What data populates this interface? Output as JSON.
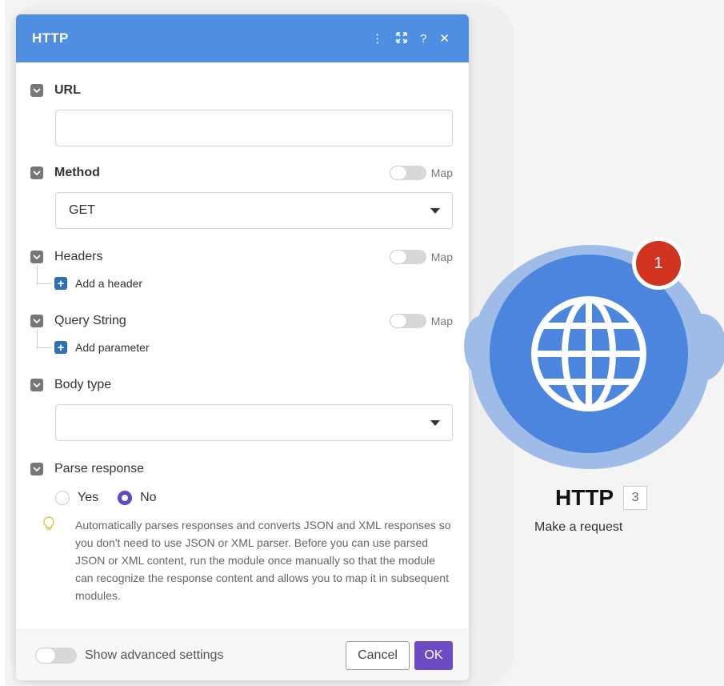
{
  "panel": {
    "title": "HTTP",
    "header_icons": [
      "more-icon",
      "expand-icon",
      "help-icon",
      "close-icon"
    ]
  },
  "fields": {
    "url": {
      "label": "URL",
      "value": ""
    },
    "method": {
      "label": "Method",
      "map_label": "Map",
      "value": "GET"
    },
    "headers": {
      "label": "Headers",
      "map_label": "Map",
      "add_label": "Add a header"
    },
    "query": {
      "label": "Query String",
      "map_label": "Map",
      "add_label": "Add parameter"
    },
    "body_type": {
      "label": "Body type",
      "value": ""
    },
    "parse": {
      "label": "Parse response",
      "options": [
        "Yes",
        "No"
      ],
      "selected": "No",
      "hint": "Automatically parses responses and converts JSON and XML responses so you don't need to use JSON or XML parser. Before you can use parsed JSON or XML content, run the module once manually so that the module can recognize the response content and allows you to map it in subsequent modules."
    }
  },
  "footer": {
    "advanced_label": "Show advanced settings",
    "cancel_label": "Cancel",
    "ok_label": "OK"
  },
  "module": {
    "badge": "1",
    "name": "HTTP",
    "id": "3",
    "subtitle": "Make a request",
    "colors": {
      "module": "#4c85dd",
      "halo": "#9fbbe8",
      "badge": "#d0331f",
      "accent": "#6c4bc5"
    }
  }
}
